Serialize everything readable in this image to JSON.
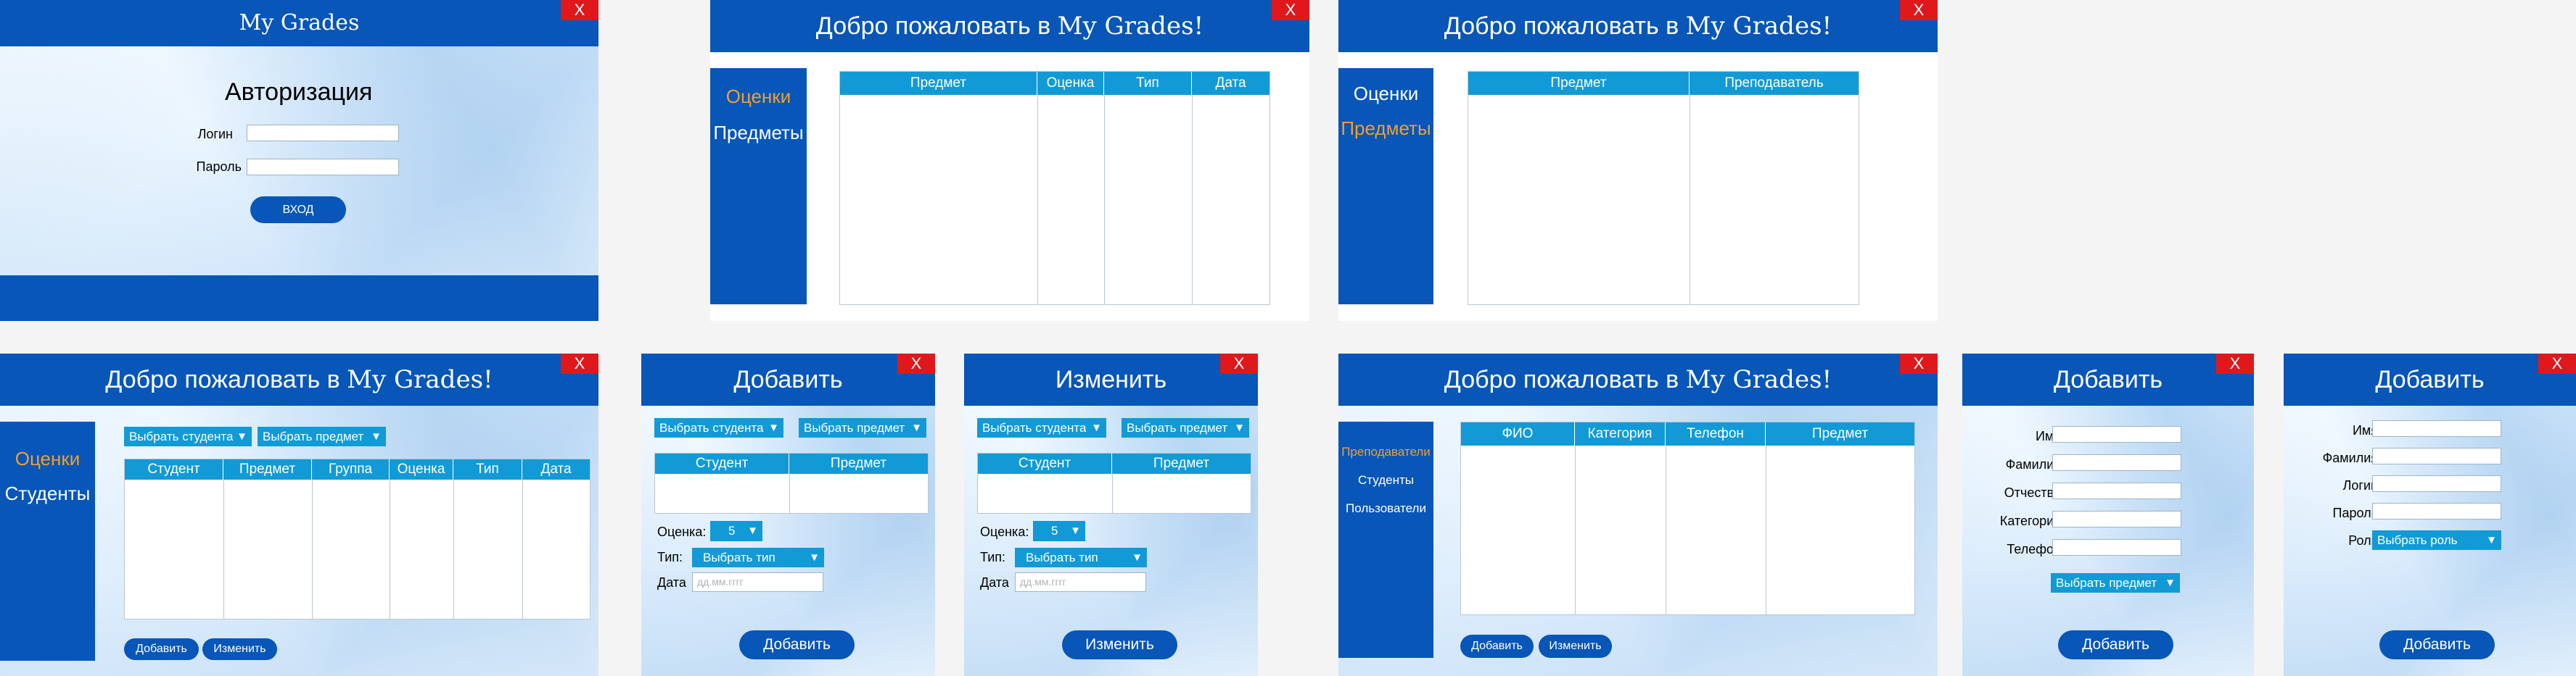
{
  "common": {
    "close": "X",
    "welcome": "Добро пожаловать в",
    "brand": "My Grades!"
  },
  "login": {
    "title": "My Grades",
    "heading": "Авторизация",
    "login_label": "Логин",
    "password_label": "Пароль",
    "submit": "ВХОД"
  },
  "student_grades": {
    "nav": [
      "Оценки",
      "Предметы"
    ],
    "columns": [
      "Предмет",
      "Оценка",
      "Тип",
      "Дата"
    ]
  },
  "student_subjects": {
    "nav": [
      "Оценки",
      "Предметы"
    ],
    "columns": [
      "Предмет",
      "Преподаватель"
    ]
  },
  "teacher": {
    "nav": [
      "Оценки",
      "Студенты"
    ],
    "filter_student": "Выбрать студента",
    "filter_subject": "Выбрать предмет",
    "columns": [
      "Студент",
      "Предмет",
      "Группа",
      "Оценка",
      "Тип",
      "Дата"
    ],
    "add": "Добавить",
    "edit": "Изменить"
  },
  "grade_add": {
    "title": "Добавить",
    "filter_student": "Выбрать студента",
    "filter_subject": "Выбрать предмет",
    "columns": [
      "Студент",
      "Предмет"
    ],
    "grade_label": "Оценка:",
    "grade_value": "5",
    "type_label": "Тип:",
    "type_value": "Выбрать тип",
    "date_label": "Дата",
    "date_placeholder": "дд.мм.гггг",
    "submit": "Добавить"
  },
  "grade_edit": {
    "title": "Изменить",
    "filter_student": "Выбрать студента",
    "filter_subject": "Выбрать предмет",
    "columns": [
      "Студент",
      "Предмет"
    ],
    "grade_label": "Оценка:",
    "grade_value": "5",
    "type_label": "Тип:",
    "type_value": "Выбрать тип",
    "date_label": "Дата",
    "date_placeholder": "дд.мм.гггг",
    "submit": "Изменить"
  },
  "admin": {
    "nav": [
      "Преподаватели",
      "Студенты",
      "Пользователи"
    ],
    "columns": [
      "ФИО",
      "Категория",
      "Телефон",
      "Предмет"
    ],
    "add": "Добавить",
    "edit": "Изменить"
  },
  "teacher_add": {
    "title": "Добавить",
    "labels": [
      "Имя",
      "Фамилия",
      "Отчество",
      "Категория",
      "Телефон"
    ],
    "subject_select": "Выбрать предмет",
    "submit": "Добавить"
  },
  "user_add": {
    "title": "Добавить",
    "labels": [
      "Имя",
      "Фамилия",
      "Логин",
      "Пароль",
      "Роль"
    ],
    "role_select": "Выбрать роль",
    "submit": "Добавить"
  },
  "colors": {
    "primary": "#0756b8",
    "accent": "#129ad6",
    "active_nav": "#f0a030",
    "close": "#e0181c"
  }
}
